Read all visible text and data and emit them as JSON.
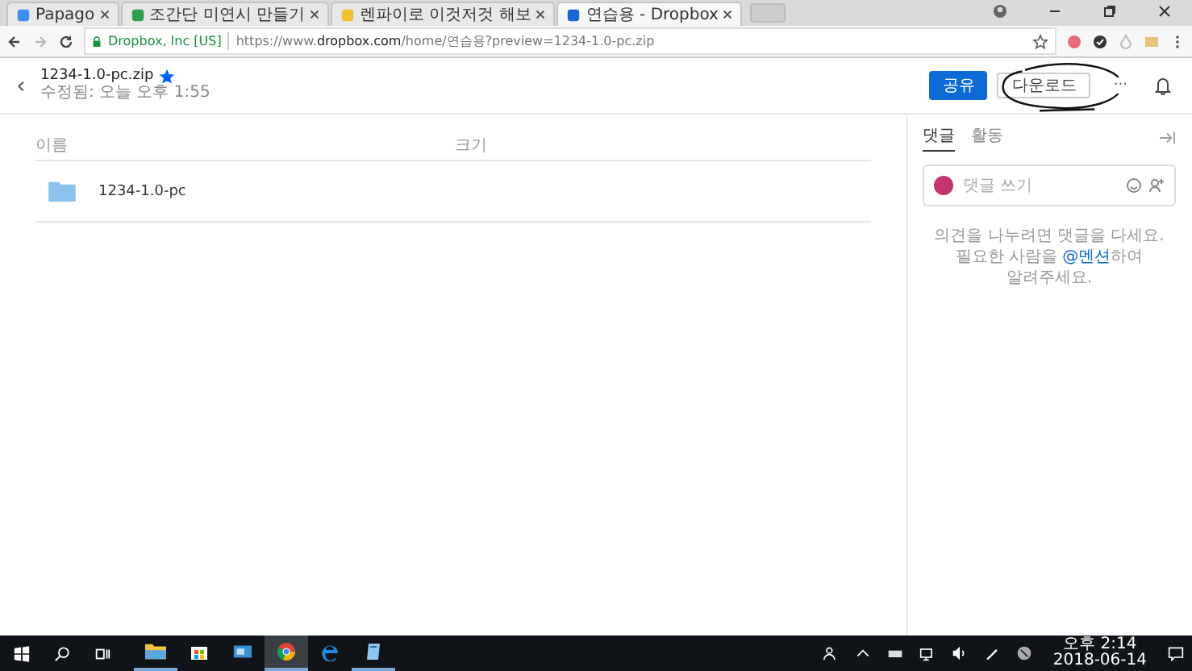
{
  "browser": {
    "tabs": [
      {
        "kind": "papago",
        "title": "Papago",
        "selected": false
      },
      {
        "kind": "sheet",
        "title": "조간단 미연시 만들기",
        "selected": false
      },
      {
        "kind": "bulb",
        "title": "렌파이로 이것저것 해보",
        "selected": false
      },
      {
        "kind": "dropbox",
        "title": "연습용 - Dropbox",
        "selected": true
      }
    ],
    "security": "Dropbox, Inc [US]",
    "url": "https://www.**dropbox.com**/home/연습용?preview=1234-1.0-pc.zip"
  },
  "file": {
    "name": "1234-1.0-pc.zip",
    "starred": true,
    "modified": "수정됨: 오늘 오후 1:55"
  },
  "actions": {
    "share": "공유",
    "download": "다운로드",
    "more": "···"
  },
  "table": {
    "columns": [
      "이름",
      "크기"
    ],
    "rows": [
      {
        "kind": "folder",
        "name": "1234-1.0-pc"
      }
    ]
  },
  "panel": {
    "tabs": [
      {
        "label": "댓글",
        "selected": true
      },
      {
        "label": "활동",
        "selected": false
      }
    ],
    "placeholder": "댓글 쓰기",
    "hint_before": "의견을 나누려면 댓글을 다세요. 필요한 사람을",
    "mention": "@멘션",
    "hint_after": "하여 알려주세요."
  },
  "taskbar": {
    "apps": [
      {
        "kind": "explorer",
        "running": true
      },
      {
        "kind": "store",
        "running": false
      },
      {
        "kind": "mail",
        "running": false
      },
      {
        "kind": "chrome",
        "running": true
      },
      {
        "kind": "edge",
        "running": false
      },
      {
        "kind": "notes",
        "running": true
      }
    ],
    "time": "오후 2:14",
    "date": "2018-06-14"
  }
}
